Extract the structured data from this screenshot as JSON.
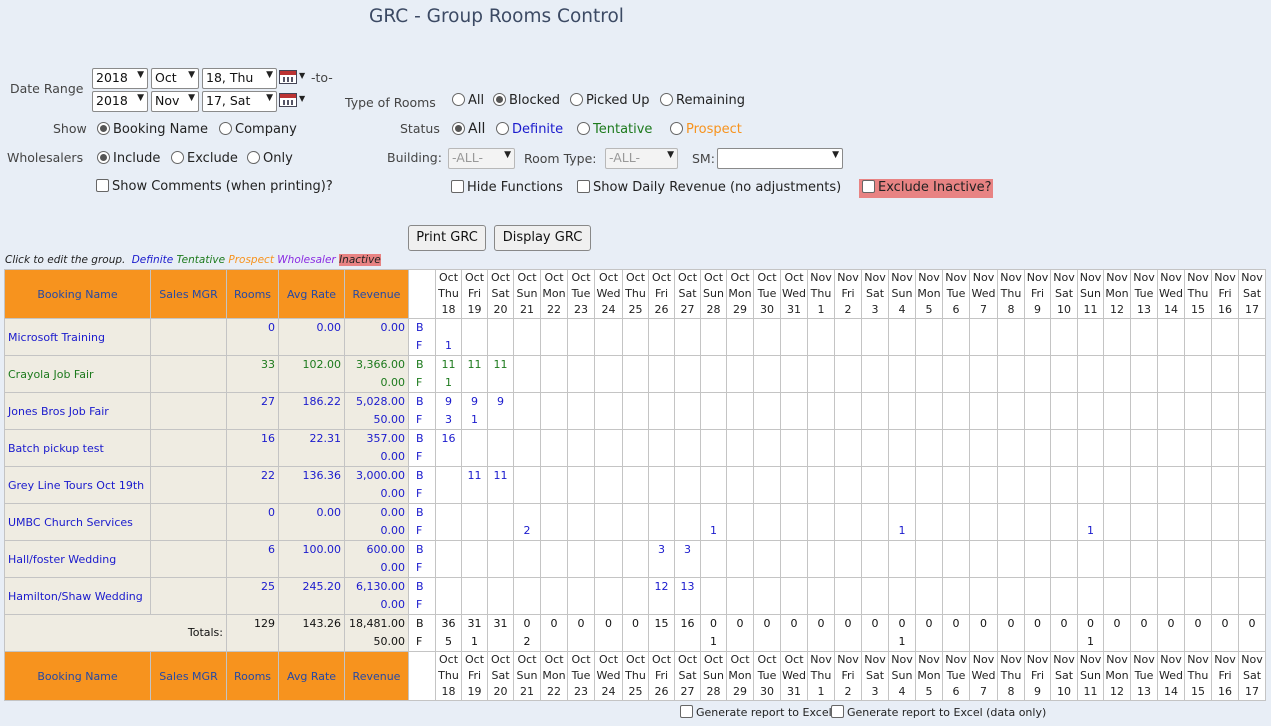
{
  "title": "GRC - Group Rooms Control",
  "date_range": {
    "label": "Date Range",
    "to_label": "-to-",
    "from": {
      "year": "2018",
      "month": "Oct",
      "day": "18, Thu"
    },
    "to": {
      "year": "2018",
      "month": "Nov",
      "day": "17, Sat"
    }
  },
  "type_of_rooms": {
    "label": "Type of Rooms",
    "options": [
      "All",
      "Blocked",
      "Picked Up",
      "Remaining"
    ],
    "selected": "Blocked"
  },
  "show": {
    "label": "Show",
    "options": [
      "Booking Name",
      "Company"
    ],
    "selected": "Booking Name"
  },
  "status": {
    "label": "Status",
    "options": [
      "All",
      "Definite",
      "Tentative",
      "Prospect"
    ],
    "selected": "All"
  },
  "wholesalers": {
    "label": "Wholesalers",
    "options": [
      "Include",
      "Exclude",
      "Only"
    ],
    "selected": "Include"
  },
  "building": {
    "label": "Building:",
    "value": "-ALL-"
  },
  "room_type": {
    "label": "Room Type:",
    "value": "-ALL-"
  },
  "sm": {
    "label": "SM:",
    "value": ""
  },
  "checkboxes": {
    "show_comments": "Show Comments (when printing)?",
    "hide_functions": "Hide Functions",
    "show_daily_revenue": "Show Daily Revenue (no adjustments)",
    "exclude_inactive": "Exclude Inactive?"
  },
  "buttons": {
    "print": "Print GRC",
    "display": "Display GRC"
  },
  "legend": {
    "intro": "Click to edit the group.",
    "definite": "Definite",
    "tentative": "Tentative",
    "prospect": "Prospect",
    "wholesaler": "Wholesaler",
    "inactive": "Inactive"
  },
  "colors": {
    "definite": "#1a1acd",
    "tentative": "#1d7a1d",
    "prospect": "#f7931e",
    "wholesaler": "#8a2be2",
    "inactive": "#e88383",
    "header": "#f7931e"
  },
  "table": {
    "headers": [
      "Booking Name",
      "Sales MGR",
      "Rooms",
      "Avg Rate",
      "Revenue"
    ],
    "dates": [
      {
        "m": "Oct",
        "d": "Thu",
        "n": "18"
      },
      {
        "m": "Oct",
        "d": "Fri",
        "n": "19"
      },
      {
        "m": "Oct",
        "d": "Sat",
        "n": "20"
      },
      {
        "m": "Oct",
        "d": "Sun",
        "n": "21"
      },
      {
        "m": "Oct",
        "d": "Mon",
        "n": "22"
      },
      {
        "m": "Oct",
        "d": "Tue",
        "n": "23"
      },
      {
        "m": "Oct",
        "d": "Wed",
        "n": "24"
      },
      {
        "m": "Oct",
        "d": "Thu",
        "n": "25"
      },
      {
        "m": "Oct",
        "d": "Fri",
        "n": "26"
      },
      {
        "m": "Oct",
        "d": "Sat",
        "n": "27"
      },
      {
        "m": "Oct",
        "d": "Sun",
        "n": "28"
      },
      {
        "m": "Oct",
        "d": "Mon",
        "n": "29"
      },
      {
        "m": "Oct",
        "d": "Tue",
        "n": "30"
      },
      {
        "m": "Oct",
        "d": "Wed",
        "n": "31"
      },
      {
        "m": "Nov",
        "d": "Thu",
        "n": "1"
      },
      {
        "m": "Nov",
        "d": "Fri",
        "n": "2"
      },
      {
        "m": "Nov",
        "d": "Sat",
        "n": "3"
      },
      {
        "m": "Nov",
        "d": "Sun",
        "n": "4"
      },
      {
        "m": "Nov",
        "d": "Mon",
        "n": "5"
      },
      {
        "m": "Nov",
        "d": "Tue",
        "n": "6"
      },
      {
        "m": "Nov",
        "d": "Wed",
        "n": "7"
      },
      {
        "m": "Nov",
        "d": "Thu",
        "n": "8"
      },
      {
        "m": "Nov",
        "d": "Fri",
        "n": "9"
      },
      {
        "m": "Nov",
        "d": "Sat",
        "n": "10"
      },
      {
        "m": "Nov",
        "d": "Sun",
        "n": "11"
      },
      {
        "m": "Nov",
        "d": "Mon",
        "n": "12"
      },
      {
        "m": "Nov",
        "d": "Tue",
        "n": "13"
      },
      {
        "m": "Nov",
        "d": "Wed",
        "n": "14"
      },
      {
        "m": "Nov",
        "d": "Thu",
        "n": "15"
      },
      {
        "m": "Nov",
        "d": "Fri",
        "n": "16"
      },
      {
        "m": "Nov",
        "d": "Sat",
        "n": "17"
      }
    ],
    "rows": [
      {
        "name": "Microsoft Training",
        "status": "definite",
        "mgr": "",
        "rooms": "0",
        "rate": "0.00",
        "revenue": "0.00",
        "revenue_f": "",
        "b": {},
        "f": {
          "0": "1"
        }
      },
      {
        "name": "Crayola Job Fair",
        "status": "tentative",
        "mgr": "",
        "rooms": "33",
        "rate": "102.00",
        "revenue": "3,366.00",
        "revenue_f": "0.00",
        "b": {
          "0": "11",
          "1": "11",
          "2": "11"
        },
        "f": {
          "0": "1"
        }
      },
      {
        "name": "Jones Bros Job Fair",
        "status": "definite",
        "mgr": "",
        "rooms": "27",
        "rate": "186.22",
        "revenue": "5,028.00",
        "revenue_f": "50.00",
        "b": {
          "0": "9",
          "1": "9",
          "2": "9"
        },
        "f": {
          "0": "3",
          "1": "1"
        }
      },
      {
        "name": "Batch pickup test",
        "status": "definite",
        "mgr": "",
        "rooms": "16",
        "rate": "22.31",
        "revenue": "357.00",
        "revenue_f": "0.00",
        "b": {
          "0": "16"
        },
        "f": {}
      },
      {
        "name": "Grey Line Tours Oct 19th",
        "status": "definite",
        "mgr": "",
        "rooms": "22",
        "rate": "136.36",
        "revenue": "3,000.00",
        "revenue_f": "0.00",
        "b": {
          "1": "11",
          "2": "11"
        },
        "f": {}
      },
      {
        "name": "UMBC Church Services",
        "status": "definite",
        "mgr": "",
        "rooms": "0",
        "rate": "0.00",
        "revenue": "0.00",
        "revenue_f": "0.00",
        "b": {},
        "f": {
          "3": "2",
          "10": "1",
          "17": "1",
          "24": "1"
        }
      },
      {
        "name": "Hall/foster Wedding",
        "status": "definite",
        "mgr": "",
        "rooms": "6",
        "rate": "100.00",
        "revenue": "600.00",
        "revenue_f": "0.00",
        "b": {
          "8": "3",
          "9": "3"
        },
        "f": {}
      },
      {
        "name": "Hamilton/Shaw Wedding",
        "status": "definite",
        "mgr": "",
        "rooms": "25",
        "rate": "245.20",
        "revenue": "6,130.00",
        "revenue_f": "0.00",
        "b": {
          "8": "12",
          "9": "13"
        },
        "f": {}
      }
    ],
    "totals": {
      "label": "Totals:",
      "rooms": "129",
      "rate": "143.26",
      "revenue": "18,481.00",
      "revenue_f": "50.00",
      "b": [
        "36",
        "31",
        "31",
        "0",
        "0",
        "0",
        "0",
        "0",
        "15",
        "16",
        "0",
        "0",
        "0",
        "0",
        "0",
        "0",
        "0",
        "0",
        "0",
        "0",
        "0",
        "0",
        "0",
        "0",
        "0",
        "0",
        "0",
        "0",
        "0",
        "0",
        "0"
      ],
      "f": {
        "0": "5",
        "1": "1",
        "3": "2",
        "10": "1",
        "17": "1",
        "24": "1"
      }
    },
    "bf_labels": [
      "B",
      "F"
    ]
  },
  "footer": {
    "excel": "Generate report to Excel",
    "excel_data": "Generate report to Excel (data only)"
  }
}
